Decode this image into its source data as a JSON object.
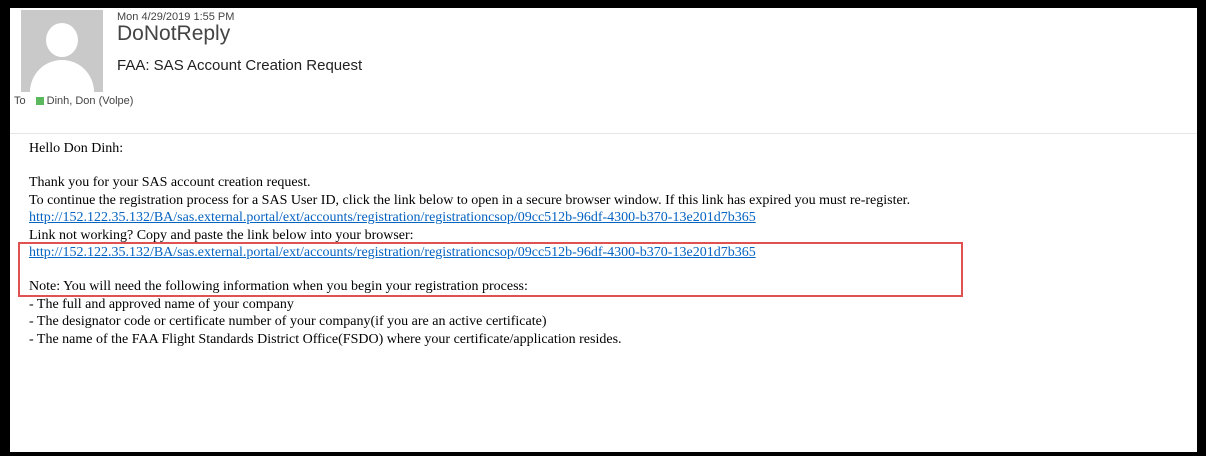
{
  "header": {
    "date": "Mon 4/29/2019 1:55 PM",
    "sender": "DoNotReply",
    "subject": "FAA: SAS Account Creation Request",
    "to_label": "To",
    "recipient": "Dinh, Don (Volpe)"
  },
  "body": {
    "greeting": "Hello Don Dinh:",
    "line1": "Thank you for your SAS account creation request.",
    "line2": "To continue the registration process for a SAS User ID, click the link below to open in a secure browser window. If this link has expired you must re-register.",
    "link1": "http://152.122.35.132/BA/sas.external.portal/ext/accounts/registration/registrationcsop/09cc512b-96df-4300-b370-13e201d7b365",
    "link_help": "Link not working? Copy and paste the link below into your browser:",
    "link2": "http://152.122.35.132/BA/sas.external.portal/ext/accounts/registration/registrationcsop/09cc512b-96df-4300-b370-13e201d7b365",
    "note_intro": "Note: You will need the following information when you begin your registration process:",
    "notes": [
      "- The full and approved name of your company",
      "- The designator code or certificate number of your company(if you are an active certificate)",
      "- The name of the FAA Flight Standards District Office(FSDO) where your certificate/application resides."
    ]
  },
  "colors": {
    "link": "#0563c1",
    "highlight_box": "#e05252",
    "presence": "#5cb85c"
  }
}
